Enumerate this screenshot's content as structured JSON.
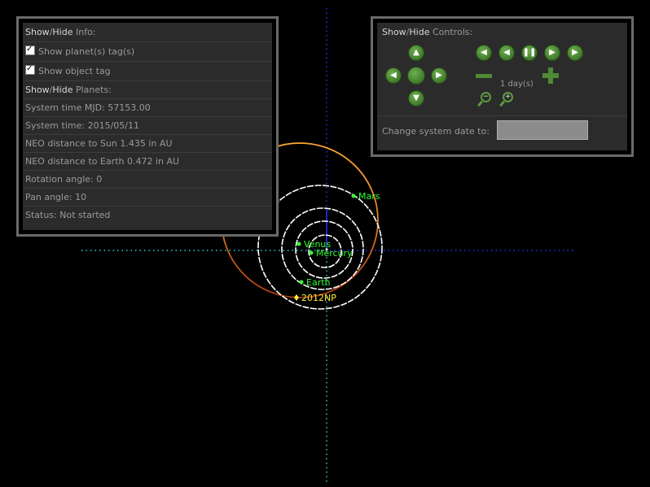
{
  "info_panel": {
    "show": "Show",
    "slash": "/",
    "hide": "Hide",
    "info_label": "Info:",
    "planets_label": "Planets:",
    "show_planet_tags": "Show planet(s) tag(s)",
    "show_object_tag": "Show object tag",
    "system_time_mjd": "System time MJD: 57153.00",
    "system_time": "System time: 2015/05/11",
    "neo_distance_sun": "NEO distance to Sun 1.435 in AU",
    "neo_distance_earth": "NEO distance to Earth 0.472 in AU",
    "rotation_angle": "Rotation angle: 0",
    "pan_angle": "Pan angle: 10",
    "status": "Status: Not started"
  },
  "controls_panel": {
    "show": "Show",
    "slash": "/",
    "hide": "Hide",
    "controls_label": "Controls:",
    "step_label": "1 day(s)",
    "change_date_label": "Change system date to:",
    "date_value": ""
  },
  "scene": {
    "planets": [
      "Mars",
      "Venus",
      "Mercury",
      "Earth"
    ],
    "object_name": "2012NP",
    "colors": {
      "orbit": "#ffffff",
      "planet_label": "#33ff33",
      "object_label": "#ffee33",
      "object_orbit": "#f0a030",
      "axis_y": "#2233ff",
      "axis_x": "#33cccc"
    }
  }
}
